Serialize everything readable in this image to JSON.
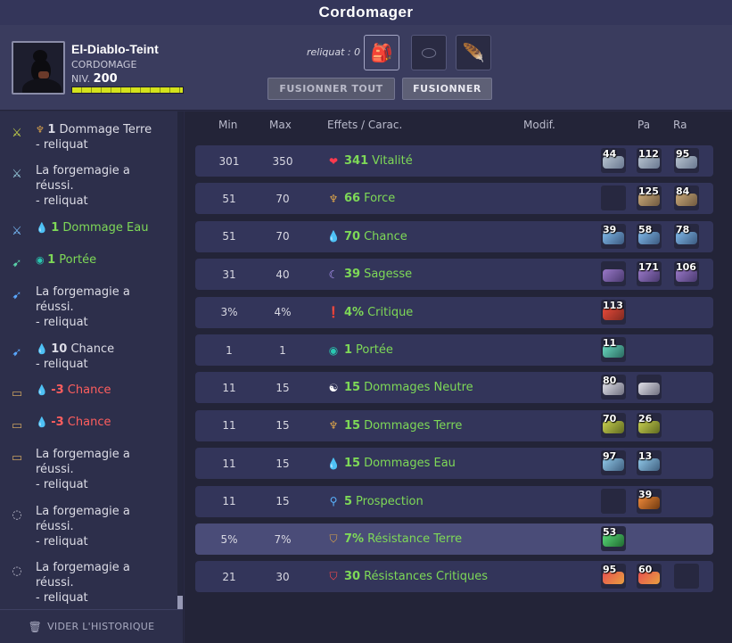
{
  "window": {
    "title": "Cordomager"
  },
  "player": {
    "name": "El-Diablo-Teint",
    "job": "CORDOMAGE",
    "level_label": "NIV.",
    "level": "200",
    "xp_fill": 1.0
  },
  "header": {
    "reliquat_label": "reliquat : 0",
    "fusion_all_label": "FUSIONNER TOUT",
    "fusion_label": "FUSIONNER"
  },
  "history": {
    "items": [
      {
        "icon": "sword-earth-icon",
        "stat_icon": "earth-icon",
        "num": "1",
        "label": "Dommage Terre",
        "line2": "- reliquat",
        "color": "normal"
      },
      {
        "icon": "sword-icon",
        "text": "La forgemagie a",
        "line2": "réussi.",
        "line3": "- reliquat"
      },
      {
        "icon": "sword-water-icon",
        "stat_icon": "water-drop-icon",
        "num": "1",
        "label": "Dommage Eau",
        "color": "green"
      },
      {
        "icon": "bow-icon",
        "stat_icon": "eye-icon",
        "num": "1",
        "label": "Portée",
        "color": "green"
      },
      {
        "icon": "bow-blue-icon",
        "text": "La forgemagie a",
        "line2": "réussi.",
        "line3": "- reliquat"
      },
      {
        "icon": "bow-blue-icon",
        "stat_icon": "water-drop-icon",
        "num": "10",
        "label": "Chance",
        "line2": "- reliquat",
        "color": "normal"
      },
      {
        "icon": "belt-icon",
        "stat_icon": "water-drop-icon",
        "num": "-3",
        "label": "Chance",
        "color": "red"
      },
      {
        "icon": "belt-icon",
        "stat_icon": "water-drop-icon",
        "num": "-3",
        "label": "Chance",
        "color": "red"
      },
      {
        "icon": "belt-icon",
        "text": "La forgemagie a",
        "line2": "réussi.",
        "line3": "- reliquat"
      },
      {
        "icon": "ring-icon",
        "text": "La forgemagie a",
        "line2": "réussi.",
        "line3": "- reliquat"
      },
      {
        "icon": "ring-icon",
        "text": "La forgemagie a",
        "line2": "réussi.",
        "line3": "- reliquat"
      }
    ],
    "clear_label": "VIDER L'HISTORIQUE"
  },
  "table": {
    "headers": {
      "min": "Min",
      "max": "Max",
      "effects": "Effets / Carac.",
      "modif": "Modif.",
      "pa": "Pa",
      "ra": "Ra"
    },
    "rows": [
      {
        "min": "301",
        "max": "350",
        "icon": "heart-icon",
        "value": "341",
        "label": "Vitalité",
        "runes": [
          "44",
          "112",
          "95"
        ]
      },
      {
        "min": "51",
        "max": "70",
        "icon": "earth-icon",
        "value": "66",
        "label": "Force",
        "runes": [
          "",
          "125",
          "84"
        ]
      },
      {
        "min": "51",
        "max": "70",
        "icon": "water-drop-icon",
        "value": "70",
        "label": "Chance",
        "runes": [
          "39",
          "58",
          "78"
        ]
      },
      {
        "min": "31",
        "max": "40",
        "icon": "moon-icon",
        "value": "39",
        "label": "Sagesse",
        "runes": [
          "",
          "171",
          "106"
        ]
      },
      {
        "min": "3%",
        "max": "4%",
        "icon": "critical-icon",
        "value": "4%",
        "label": "Critique",
        "runes": [
          "113"
        ]
      },
      {
        "min": "1",
        "max": "1",
        "icon": "eye-icon",
        "value": "1",
        "label": "Portée",
        "runes": [
          "11"
        ]
      },
      {
        "min": "11",
        "max": "15",
        "icon": "yin-yang-icon",
        "value": "15",
        "label": "Dommages Neutre",
        "runes": [
          "80",
          ""
        ]
      },
      {
        "min": "11",
        "max": "15",
        "icon": "earth-icon",
        "value": "15",
        "label": "Dommages Terre",
        "runes": [
          "70",
          "26"
        ]
      },
      {
        "min": "11",
        "max": "15",
        "icon": "water-drop-icon",
        "value": "15",
        "label": "Dommages Eau",
        "runes": [
          "97",
          "13"
        ]
      },
      {
        "min": "11",
        "max": "15",
        "icon": "magnifier-icon",
        "value": "5",
        "label": "Prospection",
        "runes": [
          "",
          "39"
        ]
      },
      {
        "min": "5%",
        "max": "7%",
        "icon": "shield-earth-icon",
        "value": "7%",
        "label": "Résistance Terre",
        "runes": [
          "53"
        ],
        "highlight": true
      },
      {
        "min": "21",
        "max": "30",
        "icon": "shield-critical-icon",
        "value": "30",
        "label": "Résistances Critiques",
        "runes": [
          "95",
          "60",
          ""
        ]
      }
    ]
  },
  "colors": {
    "green": "#7ed957",
    "red": "#ff5e5e",
    "accent": "#d4e21c"
  }
}
